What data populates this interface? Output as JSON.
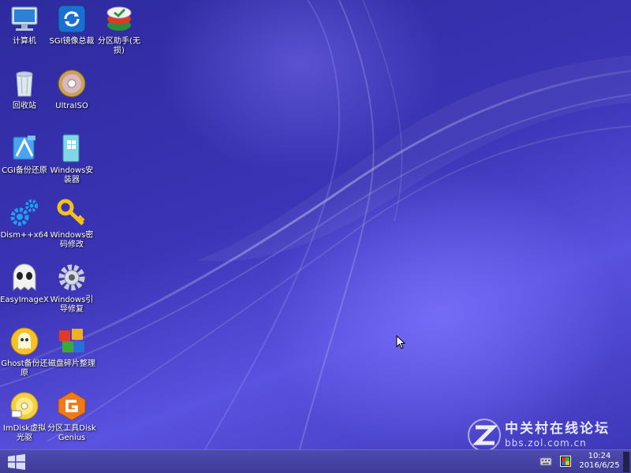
{
  "desktop": {
    "icons": [
      {
        "label": "计算机",
        "icon": "computer-icon"
      },
      {
        "label": "SGI镜像总裁",
        "icon": "sgi-sync-icon"
      },
      {
        "label": "分区助手(无损)",
        "icon": "partition-assistant-icon"
      },
      {
        "label": "回收站",
        "icon": "recycle-bin-icon"
      },
      {
        "label": "UltraISO",
        "icon": "ultraiso-disc-icon"
      },
      {
        "label": "CGI备份还原",
        "icon": "cgi-backup-icon"
      },
      {
        "label": "Windows安装器",
        "icon": "windows-installer-icon"
      },
      {
        "label": "Dism++x64",
        "icon": "dism-gears-icon"
      },
      {
        "label": "Windows密码修改",
        "icon": "key-icon"
      },
      {
        "label": "EasyImageX",
        "icon": "ghost-face-icon"
      },
      {
        "label": "Windows引导修复",
        "icon": "gear-icon"
      },
      {
        "label": "Ghost备份还原",
        "icon": "ghost-backup-icon"
      },
      {
        "label": "磁盘碎片整理",
        "icon": "defrag-blocks-icon"
      },
      {
        "label": "ImDisk虚拟光驱",
        "icon": "virtual-cd-icon"
      },
      {
        "label": "分区工具DiskGenius",
        "icon": "diskgenius-icon"
      }
    ]
  },
  "watermark": {
    "title": "中关村在线论坛",
    "url": "bbs.zol.com.cn",
    "icon": "zol-logo-icon"
  },
  "taskbar": {
    "start_icon": "windows-logo-icon",
    "tray": {
      "keyboard_icon": "keyboard-icon",
      "display_icon": "display-icon"
    },
    "clock": {
      "time": "10:24",
      "date": "2016/6/25"
    }
  },
  "colors": {
    "taskbar": "#4e4bb0",
    "wallpaper_base": "#3b34b6"
  }
}
